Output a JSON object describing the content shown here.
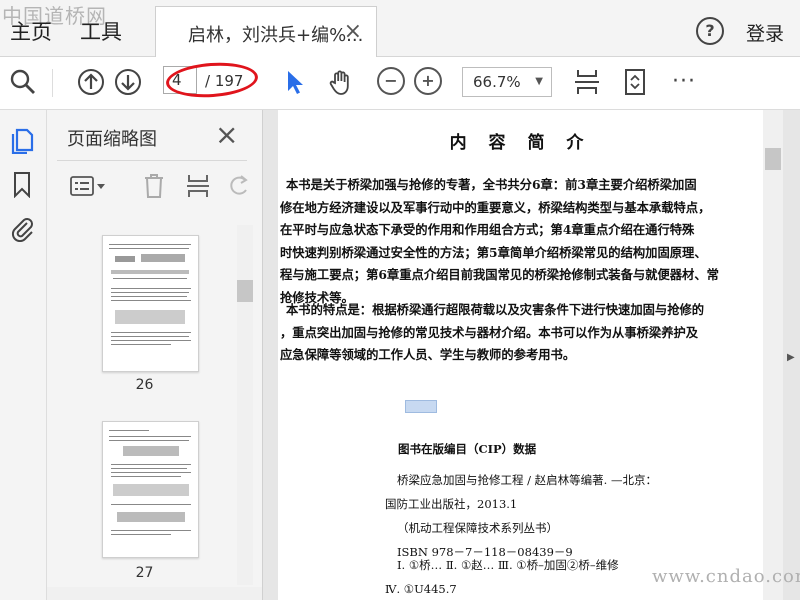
{
  "watermark_top": "中国道桥网",
  "menu": {
    "home": "主页",
    "tools": "工具"
  },
  "tab": {
    "title": "启林，刘洪兵+编%...",
    "close": "×"
  },
  "header": {
    "help": "?",
    "login": "登录"
  },
  "toolbar": {
    "page_current": "4",
    "page_total": "/ 197",
    "zoom": "66.7%",
    "more": "···"
  },
  "panel": {
    "title": "页面缩略图",
    "close": "×",
    "thumbnails": [
      {
        "page": "26"
      },
      {
        "page": "27"
      }
    ]
  },
  "document": {
    "heading": "内 容 简 介",
    "paragraph1": [
      "本书是关于桥梁加强与抢修的专著，全书共分6章：前3章主要介绍桥梁加固",
      "修在地方经济建设以及军事行动中的重要意义，桥梁结构类型与基本承载特点，",
      "在平时与应急状态下承受的作用和作用组合方式；第4章重点介绍在通行特殊",
      "时快速判别桥梁通过安全性的方法；第5章简单介绍桥梁常见的结构加固原理、",
      "程与施工要点；第6章重点介绍目前我国常见的桥梁抢修制式装备与就便器材、常",
      "抢修技术等。"
    ],
    "paragraph2": [
      "本书的特点是：根据桥梁通行超限荷载以及灾害条件下进行快速加固与抢修的",
      "，重点突出加固与抢修的常见技术与器材介绍。本书可以作为从事桥梁养护及",
      "应急保障等领域的工作人员、学生与教师的参考用书。"
    ],
    "cip_title": "图书在版编目（CIP）数据",
    "cip_lines": [
      "桥梁应急加固与抢修工程 / 赵启林等编著. —北京：",
      "国防工业出版社，2013.1",
      "（机动工程保障技术系列丛书）",
      "ISBN 978－7－118－08439－9",
      "Ⅰ. ①桥…  Ⅱ. ①赵…  Ⅲ. ①桥–加固②桥–维修",
      "Ⅳ. ①U445.7"
    ]
  },
  "watermark_bottom": "www.cndao.com",
  "colors": {
    "accent": "#2a6ee8",
    "annotation": "#e0141c",
    "selection": "#c7d9f1"
  }
}
